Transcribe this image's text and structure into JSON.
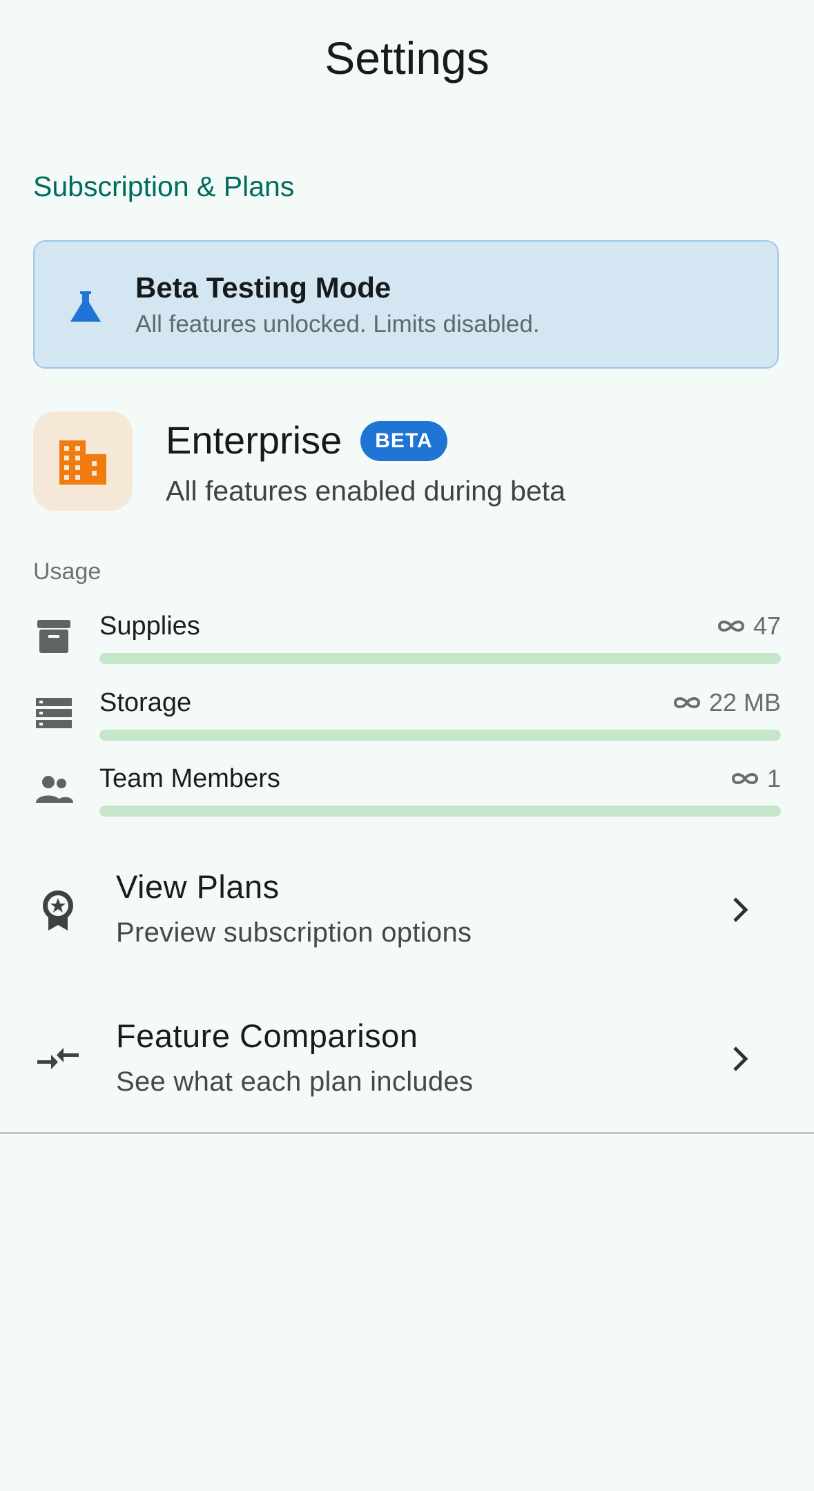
{
  "header": {
    "title": "Settings"
  },
  "section": {
    "title": "Subscription & Plans"
  },
  "beta_banner": {
    "title": "Beta Testing Mode",
    "subtitle": "All features unlocked. Limits disabled.",
    "icon": "flask-icon",
    "accent_color": "#1f74d4"
  },
  "plan": {
    "name": "Enterprise",
    "badge": "BETA",
    "description": "All features enabled during beta",
    "icon": "building-icon",
    "icon_color": "#f07c10"
  },
  "usage": {
    "label": "Usage",
    "items": [
      {
        "name": "Supplies",
        "value": "47",
        "icon": "archive-box-icon",
        "limit": "unlimited",
        "fill": 1.0
      },
      {
        "name": "Storage",
        "value": "22 MB",
        "icon": "storage-icon",
        "limit": "unlimited",
        "fill": 1.0
      },
      {
        "name": "Team Members",
        "value": "1",
        "icon": "people-icon",
        "limit": "unlimited",
        "fill": 1.0
      }
    ],
    "bar_color": "#c5e6c8"
  },
  "nav": {
    "items": [
      {
        "title": "View Plans",
        "subtitle": "Preview subscription options",
        "icon": "award-ribbon-icon"
      },
      {
        "title": "Feature Comparison",
        "subtitle": "See what each plan includes",
        "icon": "compare-arrows-icon"
      }
    ]
  }
}
